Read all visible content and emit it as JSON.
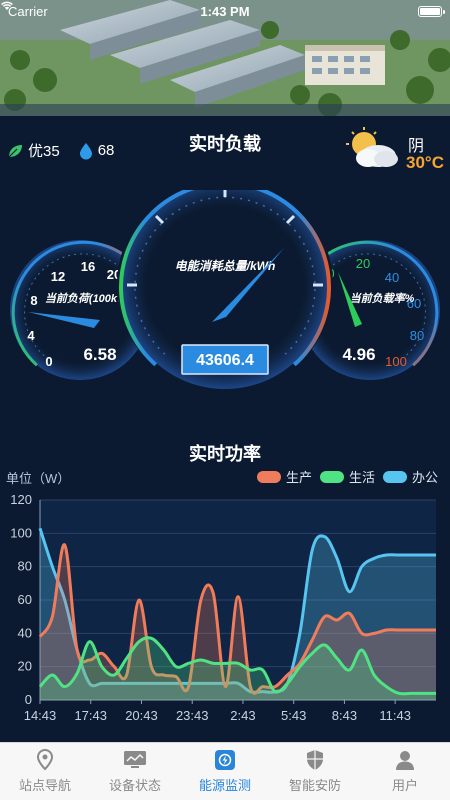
{
  "status_bar": {
    "carrier": "Carrier",
    "time": "1:43 PM"
  },
  "air": {
    "quality_label": "优35",
    "humidity": "68"
  },
  "load": {
    "title": "实时负载",
    "weather": {
      "condition": "阴",
      "temperature": "30°C"
    },
    "left_gauge": {
      "label": "当前负荷(100kW)",
      "value": 6.58,
      "value_text": "6.58",
      "ticks": [
        "0",
        "4",
        "8",
        "12",
        "16",
        "20"
      ],
      "min": 0,
      "max": 20
    },
    "center_gauge": {
      "label": "电能消耗总量/kWh",
      "value_text": "43606.4"
    },
    "right_gauge": {
      "label": "当前负载率%",
      "value": 4.96,
      "value_text": "4.96",
      "ticks": [
        "0",
        "20",
        "40",
        "60",
        "80",
        "100"
      ],
      "min": 0,
      "max": 100
    }
  },
  "power": {
    "title": "实时功率",
    "unit_label": "单位（W）",
    "legend": [
      {
        "name": "生产",
        "color": "#f07c5c"
      },
      {
        "name": "生活",
        "color": "#4fe384"
      },
      {
        "name": "办公",
        "color": "#57c5f0"
      }
    ]
  },
  "chart_data": {
    "type": "area",
    "categories": [
      "14:43",
      "17:43",
      "20:43",
      "23:43",
      "2:43",
      "5:43",
      "8:43",
      "11:43"
    ],
    "ylim": [
      0,
      120
    ],
    "yticks": [
      0,
      20,
      40,
      60,
      80,
      100,
      120
    ],
    "x": [
      0,
      0.5,
      1,
      1.5,
      2,
      2.5,
      3,
      3.5,
      4,
      4.5,
      5,
      5.5,
      6,
      6.5,
      7,
      7.5,
      8,
      8.5,
      9,
      9.5,
      10,
      10.5,
      11,
      11.5,
      12,
      12.5,
      13,
      13.5,
      14,
      14.5,
      15,
      15.5,
      16
    ],
    "series": [
      {
        "name": "生产",
        "color": "#f07c5c",
        "values": [
          38,
          50,
          93,
          30,
          24,
          28,
          20,
          15,
          60,
          20,
          15,
          14,
          8,
          60,
          64,
          8,
          62,
          8,
          8,
          8,
          15,
          22,
          36,
          50,
          48,
          52,
          40,
          40,
          42,
          42,
          42,
          42,
          42
        ]
      },
      {
        "name": "生活",
        "color": "#4fe384",
        "values": [
          8,
          15,
          8,
          16,
          35,
          20,
          15,
          25,
          35,
          37,
          30,
          20,
          22,
          24,
          22,
          22,
          22,
          18,
          18,
          5,
          10,
          20,
          28,
          33,
          25,
          18,
          30,
          15,
          8,
          4,
          4,
          4,
          4
        ]
      },
      {
        "name": "办公",
        "color": "#57c5f0",
        "values": [
          103,
          80,
          60,
          30,
          10,
          10,
          10,
          10,
          10,
          10,
          10,
          10,
          10,
          10,
          10,
          10,
          10,
          5,
          5,
          5,
          10,
          40,
          90,
          98,
          85,
          65,
          80,
          85,
          87,
          87,
          87,
          87,
          87
        ]
      }
    ]
  },
  "tabs": [
    {
      "label": "站点导航",
      "icon": "location-pin-icon",
      "active": false
    },
    {
      "label": "设备状态",
      "icon": "monitor-icon",
      "active": false
    },
    {
      "label": "能源监测",
      "icon": "energy-icon",
      "active": true
    },
    {
      "label": "智能安防",
      "icon": "shield-icon",
      "active": false
    },
    {
      "label": "用户",
      "icon": "user-icon",
      "active": false
    }
  ]
}
